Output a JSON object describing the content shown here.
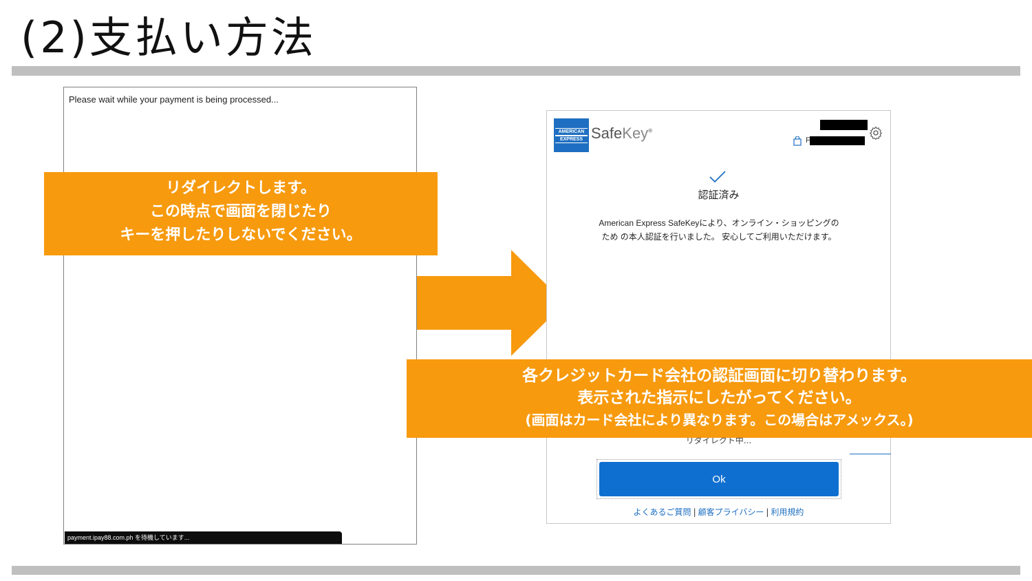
{
  "slide": {
    "title": "(2)支払い方法"
  },
  "left_window": {
    "wait_text": "Please wait while your payment is being processed...",
    "status_bar_text": "payment.ipay88.com.ph を待機しています..."
  },
  "callout_left": {
    "line1": "リダイレクトします。",
    "line2": "この時点で画面を閉じたり",
    "line3": "キーを押したりしないでください。"
  },
  "callout_right": {
    "line1": "各クレジットカード会社の認証画面に切り替わります。",
    "line2": "表示された指示にしたがってください。",
    "line3": "(画面はカード会社により異なります。この場合はアメックス。)"
  },
  "safekey": {
    "logo_top": "AMERICAN",
    "logo_bottom": "EXPRESS",
    "brand_safe": "Safe",
    "brand_key": "Key",
    "brand_mark": "®",
    "header_letter": "F",
    "verified_label": "認証済み",
    "description": "American Express SafeKeyにより、オンライン・ショッピングのため の本人認証を行いました。 安心してご利用いただけます。",
    "redirecting_text": "リダイレクト中...",
    "ok_label": "Ok",
    "footer_links": [
      "よくあるご質問",
      "顧客プライバシー",
      "利用規約"
    ]
  },
  "colors": {
    "callout": "#f79a0e",
    "amex_blue": "#1e6fc1",
    "ok_button": "#0f6fd0",
    "bar": "#bfbfbf"
  },
  "icons": [
    "check-icon",
    "gear-icon",
    "shopping-bag-icon",
    "arrow-right-icon"
  ]
}
